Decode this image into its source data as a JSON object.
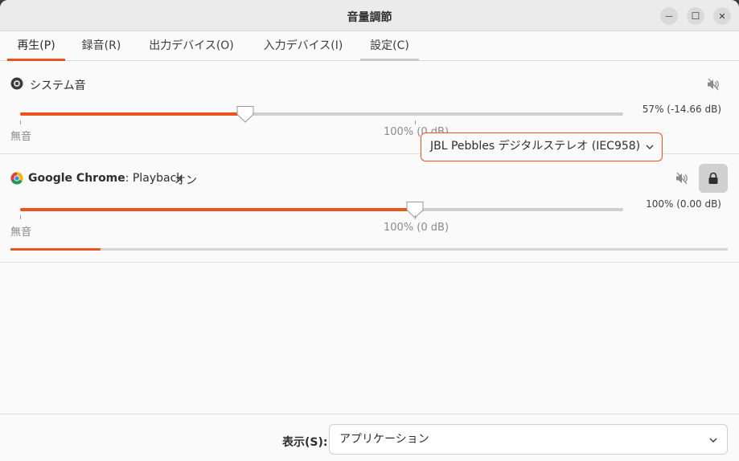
{
  "window": {
    "title": "音量調節",
    "minimize_glyph": "—",
    "maximize_glyph": "☐",
    "close_glyph": "✕"
  },
  "tabs": [
    {
      "label": "再生(P)",
      "active": true
    },
    {
      "label": "録音(R)",
      "active": false
    },
    {
      "label": "出力デバイス(O)",
      "active": false
    },
    {
      "label": "入力デバイス(I)",
      "active": false
    },
    {
      "label": "設定(C)",
      "active": false
    }
  ],
  "streams": [
    {
      "icon": "speaker-icon",
      "name": "システム音",
      "volume_label": "57% (-14.66 dB)",
      "volume_fraction": 0.57,
      "mute_label": "無音",
      "reference_label": "100% (0 dB)"
    },
    {
      "icon": "chrome-icon",
      "app_name": "Google Chrome",
      "stream_name": ": Playback",
      "status": "オン",
      "device": "JBL Pebbles デジタルステレオ (IEC958)",
      "volume_label": "100% (0.00 dB)",
      "volume_fraction": 1.0,
      "mute_label": "無音",
      "reference_label": "100% (0 dB)",
      "peak_level_fraction": 0.125
    }
  ],
  "bottom": {
    "show_label": "表示(S):",
    "show_value": "アプリケーション"
  },
  "colors": {
    "accent": "#e95420",
    "track": "#cfcfcf"
  }
}
